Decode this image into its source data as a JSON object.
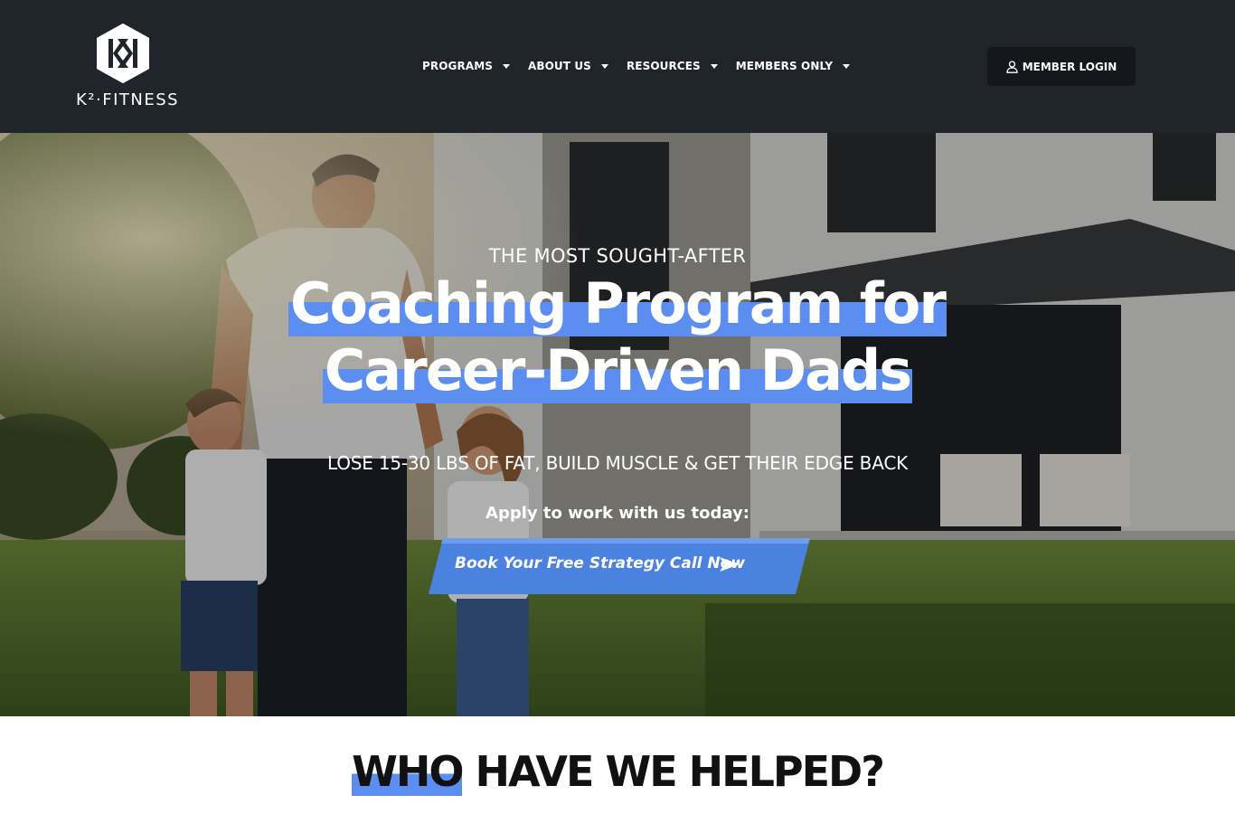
{
  "brand": {
    "logo_text": "K²·FITNESS",
    "logo_monogram": "KK"
  },
  "nav": {
    "items": [
      {
        "label": "PROGRAMS"
      },
      {
        "label": "ABOUT US"
      },
      {
        "label": "RESOURCES"
      },
      {
        "label": "MEMBERS ONLY"
      }
    ],
    "login_label": "MEMBER LOGIN",
    "login_icon": "user-icon"
  },
  "hero": {
    "eyebrow": "THE MOST SOUGHT-AFTER",
    "headline_line1": "Coaching Program for",
    "headline_line2": "Career-Driven Dads",
    "subline": "LOSE 15-30 LBS OF FAT, BUILD MUSCLE & GET THEIR EDGE BACK",
    "apply_text": "Apply to work with us today:",
    "cta_label": "Book Your Free Strategy Call Now",
    "cta_icon": "arrow-right-icon"
  },
  "section": {
    "title_highlight": "WHO",
    "title_rest": " HAVE WE HELPED?"
  },
  "colors": {
    "header_bg": "#20252c",
    "accent": "#5b8ef0",
    "button_bg": "#14181d"
  }
}
